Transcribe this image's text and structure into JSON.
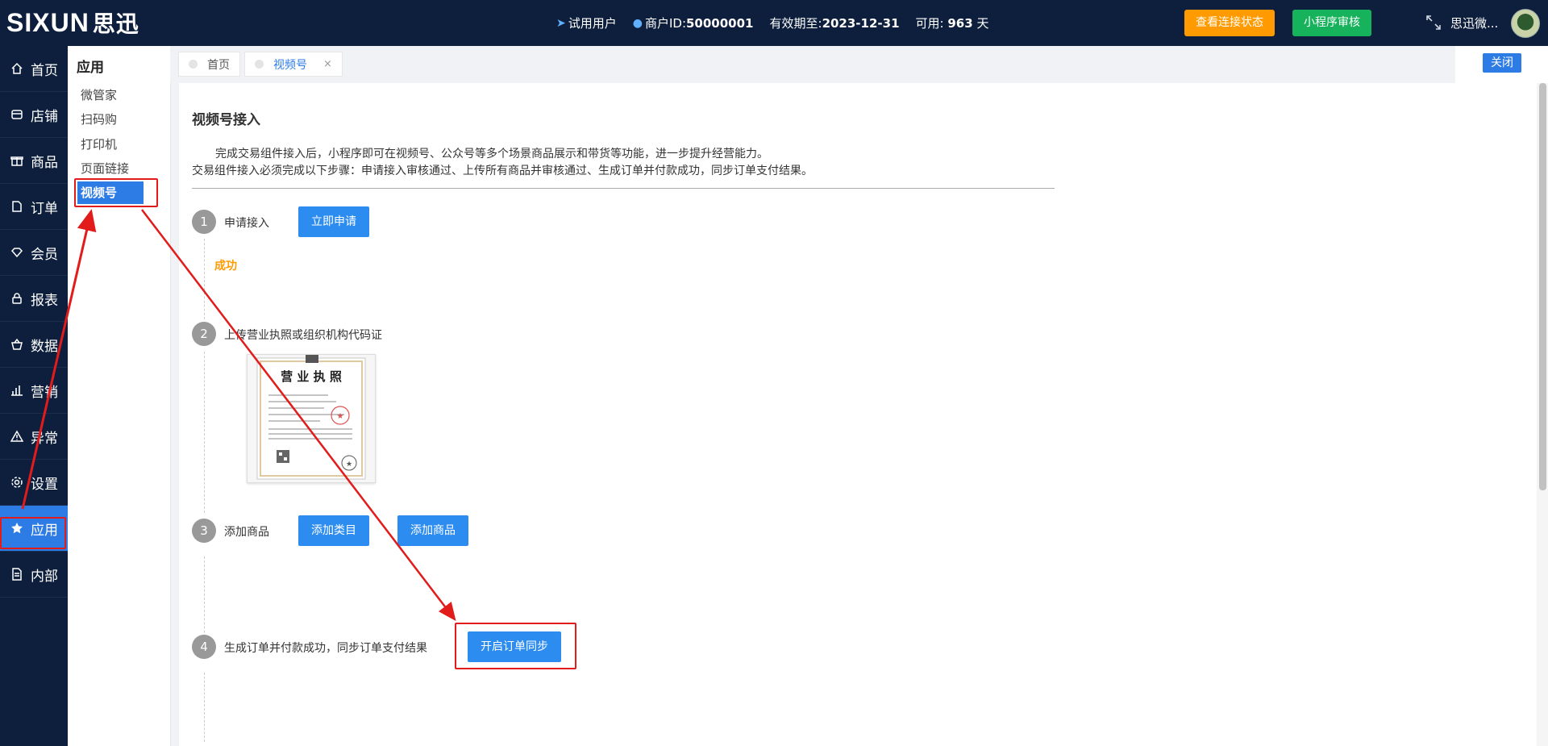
{
  "header": {
    "logo_text": "SIXUN",
    "logo_cn": "思迅",
    "user_type": "试用用户",
    "merchant_label": "商户ID:",
    "merchant_id": "50000001",
    "expiry_label": "有效期至:",
    "expiry_date": "2023-12-31",
    "available_label": "可用:",
    "available_days": "963",
    "available_unit": "天",
    "check_status_button": "查看连接状态",
    "miniprogram_review_button": "小程序审核",
    "username": "思迅微..."
  },
  "sidebar": {
    "items": [
      {
        "label": "首页",
        "icon": "home-icon"
      },
      {
        "label": "店铺",
        "icon": "store-icon"
      },
      {
        "label": "商品",
        "icon": "gift-icon"
      },
      {
        "label": "订单",
        "icon": "order-icon"
      },
      {
        "label": "会员",
        "icon": "diamond-icon"
      },
      {
        "label": "报表",
        "icon": "lock-icon"
      },
      {
        "label": "数据",
        "icon": "basket-icon"
      },
      {
        "label": "营销",
        "icon": "bar-chart-icon"
      },
      {
        "label": "异常",
        "icon": "warning-icon"
      },
      {
        "label": "设置",
        "icon": "gear-icon"
      },
      {
        "label": "应用",
        "icon": "star-icon"
      },
      {
        "label": "内部",
        "icon": "document-icon"
      }
    ],
    "active_index": 10
  },
  "subnav": {
    "title": "应用",
    "items": [
      "微管家",
      "扫码购",
      "打印机",
      "页面链接",
      "视频号"
    ],
    "active_index": 4
  },
  "tabs": {
    "items": [
      {
        "label": "首页"
      },
      {
        "label": "视频号",
        "close": "×"
      }
    ],
    "close_button": "关闭"
  },
  "content": {
    "title": "视频号接入",
    "description_1": "完成交易组件接入后，小程序即可在视频号、公众号等多个场景商品展示和带货等功能，进一步提升经营能力。",
    "description_2": "交易组件接入必须完成以下步骤：申请接入审核通过、上传所有商品并审核通过、生成订单并付款成功，同步订单支付结果。",
    "steps": [
      {
        "number": "1",
        "label": "申请接入",
        "buttons": [
          "立即申请"
        ],
        "status": "成功"
      },
      {
        "number": "2",
        "label": "上传营业执照或组织机构代码证"
      },
      {
        "number": "3",
        "label": "添加商品",
        "buttons": [
          "添加类目",
          "添加商品"
        ]
      },
      {
        "number": "4",
        "label": "生成订单并付款成功，同步订单支付结果",
        "buttons": [
          "开启订单同步"
        ]
      }
    ],
    "license_title": "营 业 执 照"
  },
  "colors": {
    "topbar": "#0d1f3c",
    "accent": "#2d7be5",
    "primary_button": "#2d8cf0",
    "orange": "#ff9a00",
    "green": "#17b25c",
    "annotation_red": "#e21b1b"
  }
}
